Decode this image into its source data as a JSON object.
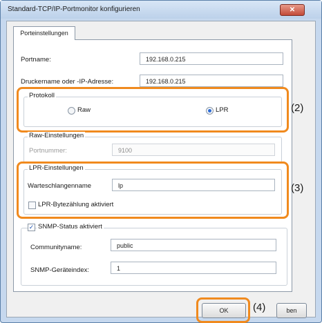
{
  "window": {
    "title": "Standard-TCP/IP-Portmonitor konfigurieren",
    "close_symbol": "✕"
  },
  "tab": {
    "label": "Porteinstellungen"
  },
  "port": {
    "portname_label": "Portname:",
    "portname_value": "192.168.0.215",
    "host_label": "Druckername oder -IP-Adresse:",
    "host_value": "192.168.0.215"
  },
  "protocol": {
    "title": "Protokoll",
    "raw_label": "Raw",
    "lpr_label": "LPR",
    "selected": "LPR"
  },
  "raw_settings": {
    "title": "Raw-Einstellungen",
    "portnumber_label": "Portnummer:",
    "portnumber_value": "9100"
  },
  "lpr_settings": {
    "title": "LPR-Einstellungen",
    "queue_label": "Warteschlangenname",
    "queue_value": "lp",
    "bytecount_label": "LPR-Bytezählung aktiviert",
    "bytecount_checked": false
  },
  "snmp": {
    "title": "SNMP-Status aktiviert",
    "checked": true,
    "community_label": "Communityname:",
    "community_value": "public",
    "index_label": "SNMP-Geräteindex:",
    "index_value": "1"
  },
  "buttons": {
    "ok": "OK",
    "cancel_partial": "ben"
  },
  "callouts": {
    "c2": "(2)",
    "c3": "(3)",
    "c4": "(4)"
  },
  "colors": {
    "highlight": "#f08a1e",
    "radio_selected": "#2a6ad6",
    "close_button": "#c24a38"
  }
}
